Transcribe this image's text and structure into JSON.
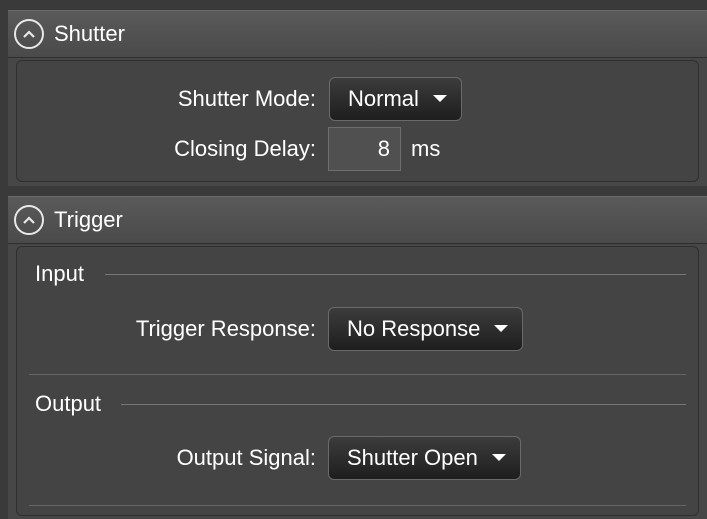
{
  "shutter": {
    "title": "Shutter",
    "shutter_mode_label": "Shutter Mode:",
    "shutter_mode_value": "Normal",
    "closing_delay_label": "Closing Delay:",
    "closing_delay_value": "8",
    "closing_delay_unit": "ms"
  },
  "trigger": {
    "title": "Trigger",
    "input_group": "Input",
    "trigger_response_label": "Trigger Response:",
    "trigger_response_value": "No Response",
    "output_group": "Output",
    "output_signal_label": "Output Signal:",
    "output_signal_value": "Shutter Open"
  },
  "icons": {
    "collapse": "chevron-up-icon",
    "dropdown": "caret-down-icon"
  }
}
